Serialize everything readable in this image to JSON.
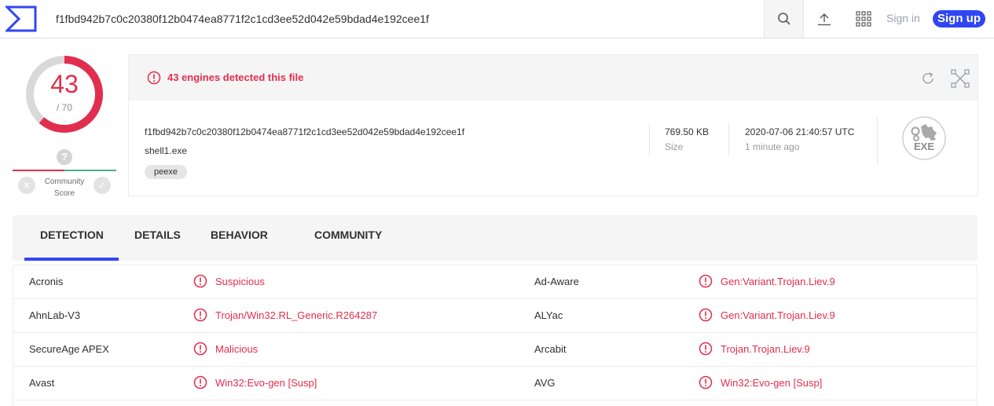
{
  "header": {
    "search_value": "f1fbd942b7c0c20380f12b0474ea8771f2c1cd3ee52d042e59bdad4e192cee1f",
    "signin_label": "Sign in",
    "signup_label": "Sign up"
  },
  "score": {
    "detected": "43",
    "total": "/ 70",
    "detection_ratio": 0.614,
    "community_label": "Community Score",
    "community_icon": "question-icon"
  },
  "alert": {
    "text": "43 engines detected this file"
  },
  "file": {
    "hash": "f1fbd942b7c0c20380f12b0474ea8771f2c1cd3ee52d042e59bdad4e192cee1f",
    "name": "shell1.exe",
    "tag": "peexe",
    "size_value": "769.50 KB",
    "size_label": "Size",
    "date_value": "2020-07-06 21:40:57 UTC",
    "date_relative": "1 minute ago",
    "type_label": "EXE"
  },
  "tabs": [
    "DETECTION",
    "DETAILS",
    "BEHAVIOR",
    "COMMUNITY"
  ],
  "detections": [
    {
      "engine_a": "Acronis",
      "result_a": "Suspicious",
      "engine_b": "Ad-Aware",
      "result_b": "Gen:Variant.Trojan.Liev.9"
    },
    {
      "engine_a": "AhnLab-V3",
      "result_a": "Trojan/Win32.RL_Generic.R264287",
      "engine_b": "ALYac",
      "result_b": "Gen:Variant.Trojan.Liev.9"
    },
    {
      "engine_a": "SecureAge APEX",
      "result_a": "Malicious",
      "engine_b": "Arcabit",
      "result_b": "Trojan.Trojan.Liev.9"
    },
    {
      "engine_a": "Avast",
      "result_a": "Win32:Evo-gen [Susp]",
      "engine_b": "AVG",
      "result_b": "Win32:Evo-gen [Susp]"
    }
  ],
  "colors": {
    "accent": "#3046f2",
    "danger": "#e22e4e",
    "success": "#4caf87"
  }
}
